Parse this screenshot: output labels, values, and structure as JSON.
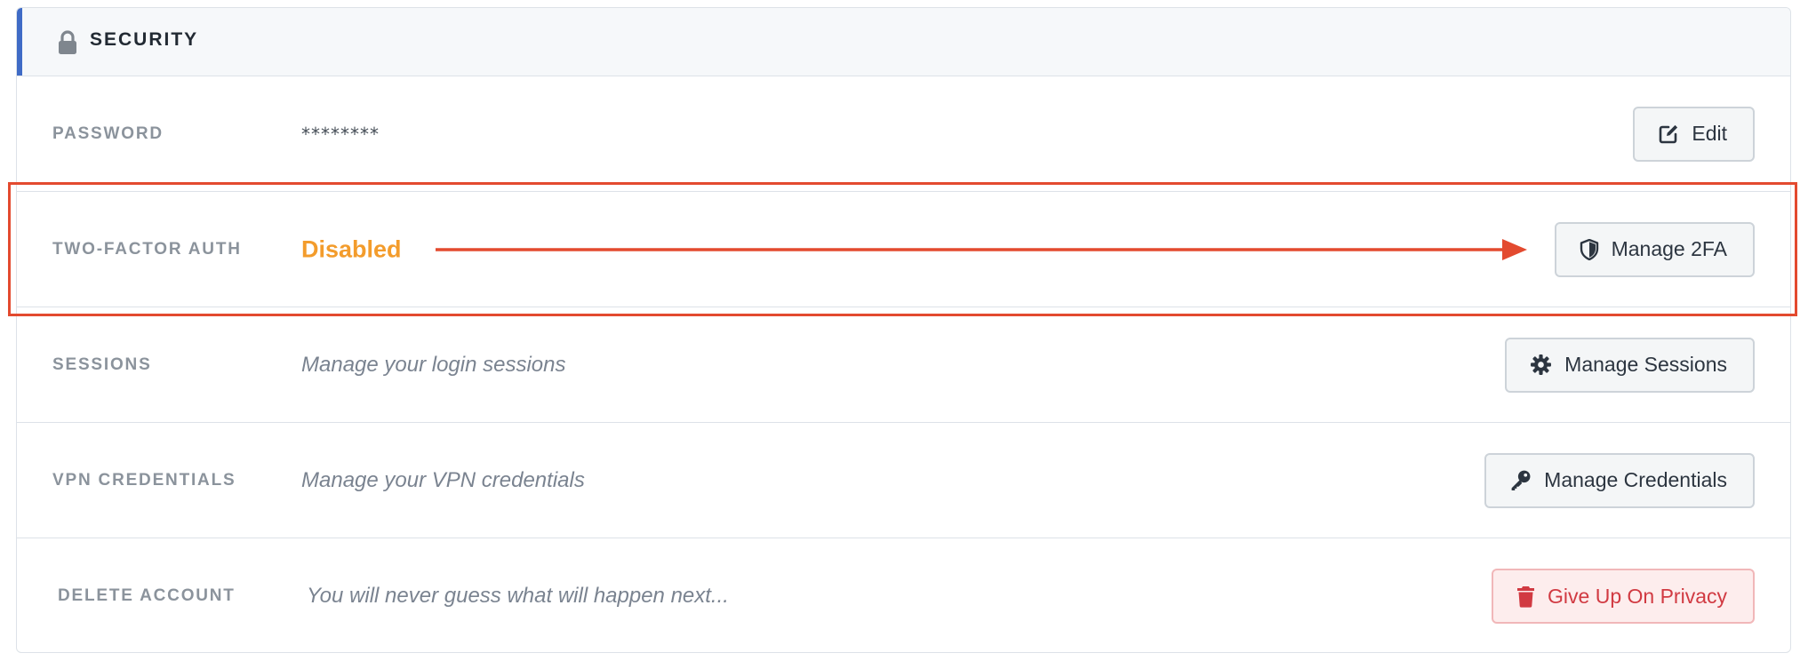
{
  "header": {
    "title": "SECURITY",
    "icon": "lock-icon",
    "accent_color": "#3f6bc6"
  },
  "rows": [
    {
      "label": "PASSWORD",
      "value": "********",
      "button": {
        "label": "Edit",
        "icon": "edit-icon"
      }
    },
    {
      "label": "TWO-FACTOR AUTH",
      "value": "Disabled",
      "value_color": "#f39c2c",
      "button": {
        "label": "Manage 2FA",
        "icon": "shield-icon"
      }
    },
    {
      "label": "SESSIONS",
      "value": "Manage your login sessions",
      "button": {
        "label": "Manage Sessions",
        "icon": "gear-icon"
      }
    },
    {
      "label": "VPN CREDENTIALS",
      "value": "Manage your VPN credentials",
      "button": {
        "label": "Manage Credentials",
        "icon": "key-icon"
      }
    },
    {
      "label": "DELETE ACCOUNT",
      "value": "You will never guess what will happen next...",
      "button": {
        "label": "Give Up On Privacy",
        "icon": "trash-icon",
        "color": "#d13a42"
      }
    }
  ],
  "annotation": {
    "color": "#e34a2f",
    "target": "Manage 2FA"
  }
}
